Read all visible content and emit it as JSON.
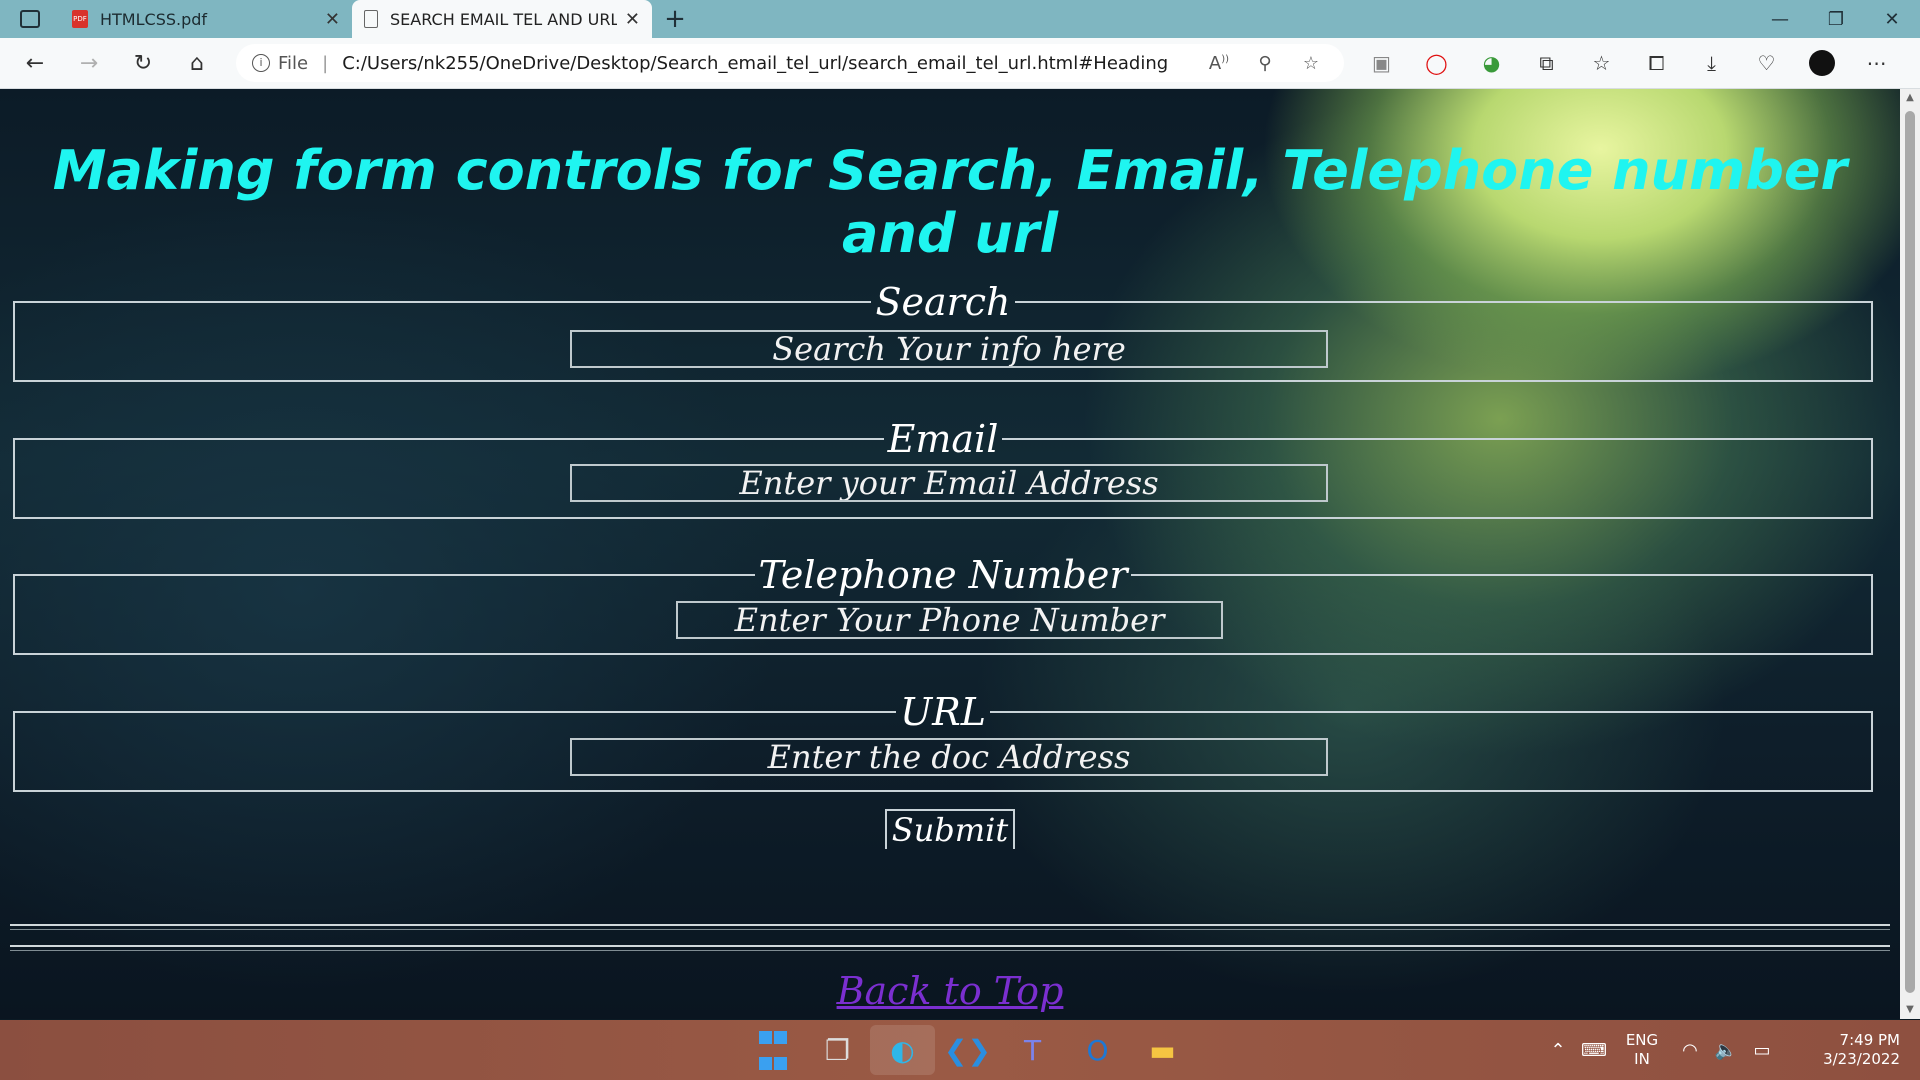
{
  "browser": {
    "tabs": [
      {
        "title": "HTMLCSS.pdf",
        "icon": "pdf-icon",
        "active": false
      },
      {
        "title": "SEARCH EMAIL TEL AND URL",
        "icon": "page-icon",
        "active": true
      }
    ],
    "address": {
      "scheme_label": "File",
      "url": "C:/Users/nk255/OneDrive/Desktop/Search_email_tel_url/search_email_tel_url.html#Heading"
    }
  },
  "page": {
    "heading": "Making form controls for Search, Email, Telephone number and url",
    "fieldsets": {
      "search": {
        "legend": "Search",
        "placeholder": "Search Your info here"
      },
      "email": {
        "legend": "Email",
        "placeholder": "Enter your Email Address"
      },
      "tel": {
        "legend": "Telephone Number",
        "placeholder": "Enter Your Phone Number"
      },
      "url": {
        "legend": "URL",
        "placeholder": "Enter the doc Address"
      }
    },
    "submit_label": "Submit",
    "back_to_top": "Back to Top"
  },
  "taskbar": {
    "language": {
      "line1": "ENG",
      "line2": "IN"
    },
    "time": "7:49 PM",
    "date": "3/23/2022"
  },
  "colors": {
    "heading": "#1ff5f0",
    "link": "#7b2fd0",
    "tabbar": "#7fb6c1",
    "taskbar": "#9a5a45"
  }
}
